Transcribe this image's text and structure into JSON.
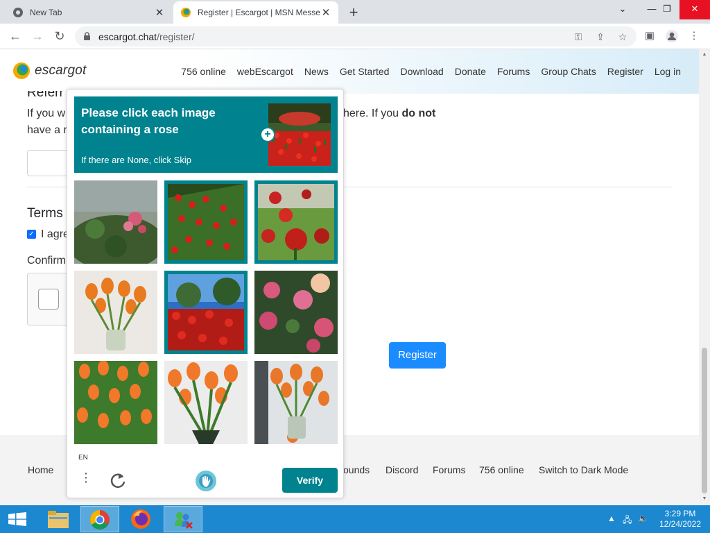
{
  "browser": {
    "tabs": [
      {
        "title": "New Tab",
        "active": false
      },
      {
        "title": "Register | Escargot | MSN Messenger",
        "active": true
      }
    ],
    "new_tab_label": "+",
    "url_host": "escargot.chat",
    "url_path": "/register/",
    "window_controls": {
      "minimize": "⌄",
      "restore": "—",
      "maximize": "❐",
      "close": "✕"
    }
  },
  "site": {
    "logo_text": "escargot",
    "nav": [
      "756 online",
      "webEscargot",
      "News",
      "Get Started",
      "Download",
      "Donate",
      "Forums",
      "Group Chats",
      "Register",
      "Log in"
    ]
  },
  "page": {
    "referral_heading": "Referr",
    "referral_text_1a": "If you w",
    "referral_text_1b": "here. If you ",
    "referral_text_1_bold": "do not",
    "referral_text_2": "have a r",
    "terms_heading": "Terms",
    "terms_checkbox_label": "I agre",
    "terms_checked": true,
    "confirm_heading": "Confirm",
    "register_button": "Register"
  },
  "footer": {
    "links": [
      "Home",
      "ounds",
      "Discord",
      "Forums",
      "756 online",
      "Switch to Dark Mode"
    ]
  },
  "hcaptcha": {
    "prompt_title": "Please click each image containing a rose",
    "prompt_sub": "If there are None, click Skip",
    "language": "EN",
    "verify_button": "Verify",
    "tiles": [
      {
        "subject": "pink rose bush",
        "selected": false
      },
      {
        "subject": "red flower field",
        "selected": true
      },
      {
        "subject": "red roses",
        "selected": true
      },
      {
        "subject": "orange tulips in vase",
        "selected": false
      },
      {
        "subject": "red flower field under sky",
        "selected": true
      },
      {
        "subject": "pink roses",
        "selected": false
      },
      {
        "subject": "orange tulips",
        "selected": false
      },
      {
        "subject": "orange tulip bouquet",
        "selected": false
      },
      {
        "subject": "orange tulips in glass vase",
        "selected": false
      }
    ],
    "accent_color": "#00838f"
  },
  "taskbar": {
    "apps": [
      "file-explorer",
      "chrome",
      "firefox",
      "msn-messenger"
    ],
    "time": "3:29 PM",
    "date": "12/24/2022"
  }
}
